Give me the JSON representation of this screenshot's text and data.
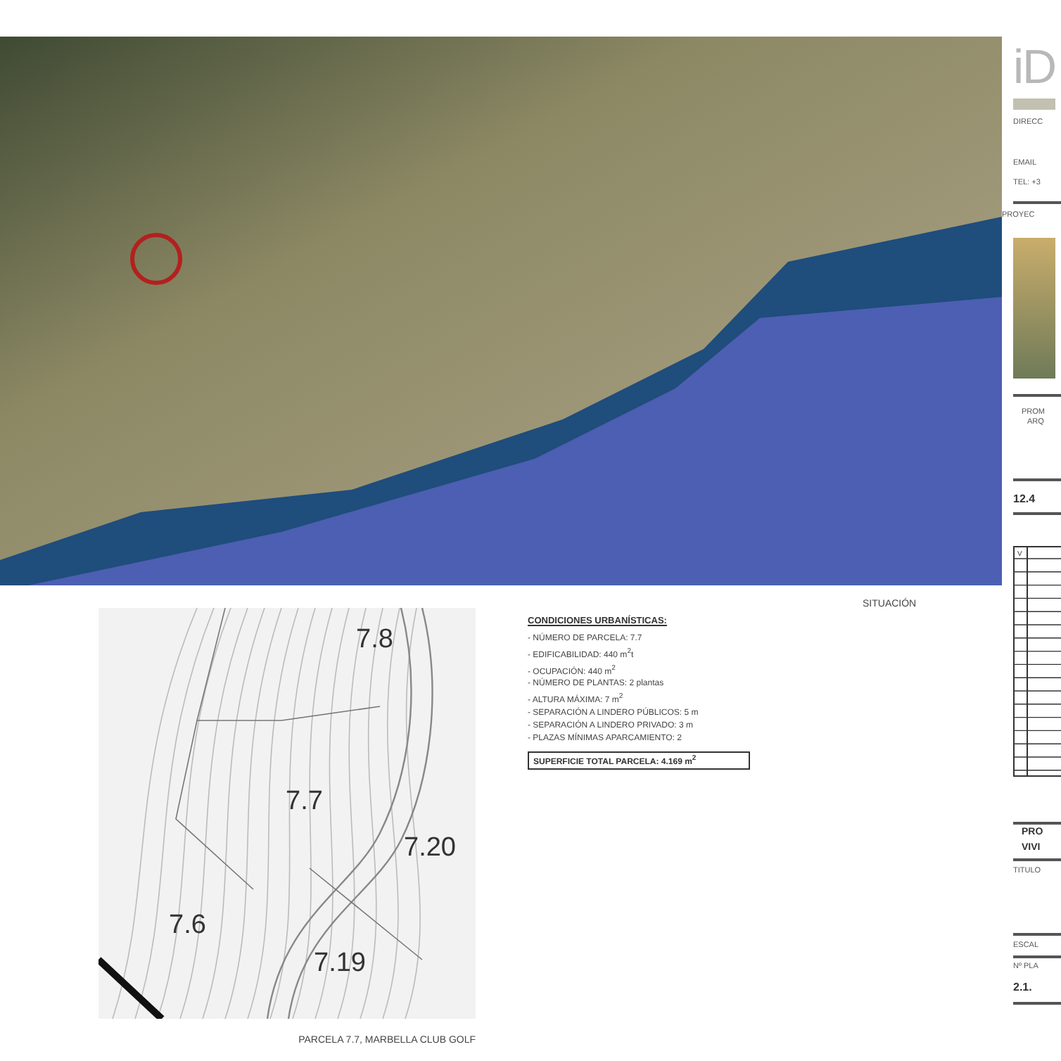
{
  "site_map": {
    "caption": "SITUACIÓN"
  },
  "plot_plan": {
    "parcels": [
      "7.8",
      "7.7",
      "7.20",
      "7.6",
      "7.19"
    ],
    "caption": "PARCELA 7.7, MARBELLA CLUB GOLF"
  },
  "conditions": {
    "title": "CONDICIONES URBANÍSTICAS:",
    "items": [
      "- NÚMERO DE PARCELA: 7.7",
      "- EDIFICABILIDAD: 440 m$^{2}$t",
      "- OCUPACIÓN: 440 m$^{2}$",
      "- NÚMERO DE PLANTAS: 2 plantas",
      "- ALTURA MÁXIMA: 7 m$^{2}$",
      "- SEPARACIÓN A LINDERO PÚBLICOS: 5 m",
      "- SEPARACIÓN A LINDERO PRIVADO: 3 m",
      "- PLAZAS MÍNIMAS APARCAMIENTO: 2"
    ],
    "total": "SUPERFICIE TOTAL PARCELA: 4.169 m$^{2}$"
  },
  "title_block": {
    "logo": "iD",
    "direction": "DIRECC",
    "email": "EMAIL",
    "phone": "TEL: +3",
    "project_label": "PROYEC",
    "promoter": "PROM",
    "architect": "ARQ",
    "date": "12.4",
    "table_header": "V",
    "project_title": [
      "PRO",
      "VIVI"
    ],
    "sheet_title_label": "TITULO",
    "scale_label": "ESCAL",
    "sheet_number_label": "Nº PLA",
    "sheet_number": "2.1."
  }
}
